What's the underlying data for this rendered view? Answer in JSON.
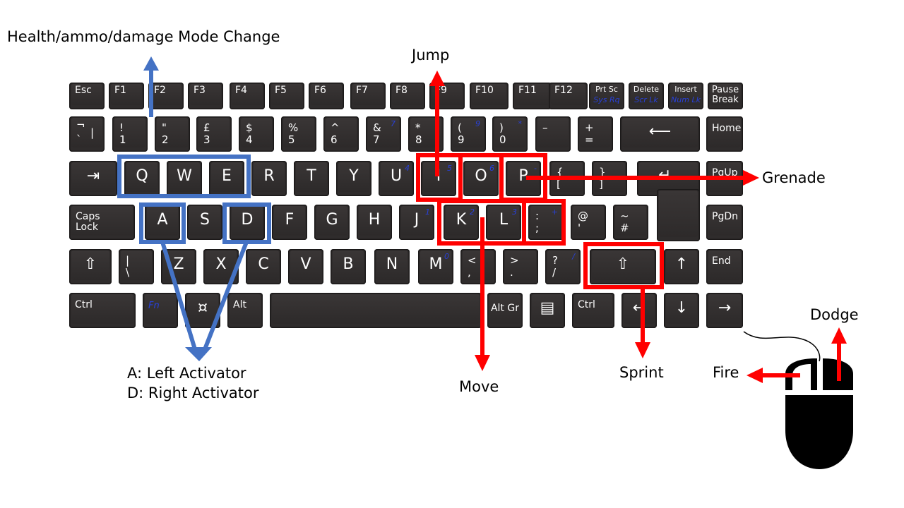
{
  "labels": {
    "health_mode": "Health/ammo/damage  Mode Change",
    "jump": "Jump",
    "grenade": "Grenade",
    "activator_a": "A:  Left Activator",
    "activator_d": "D:  Right Activator",
    "move": "Move",
    "sprint": "Sprint",
    "dodge": "Dodge",
    "fire": "Fire"
  },
  "colors": {
    "key_fill": "#2f2c2c",
    "key_text": "#ffffff",
    "fn_text": "#2840d8",
    "blue_highlight": "#4472c4",
    "red_highlight": "#ff0000",
    "mouse": "#000000"
  },
  "keys": {
    "esc": {
      "main": "Esc"
    },
    "f1": {
      "main": "F1"
    },
    "f2": {
      "main": "F2"
    },
    "f3": {
      "main": "F3"
    },
    "f4": {
      "main": "F4"
    },
    "f5": {
      "main": "F5"
    },
    "f6": {
      "main": "F6"
    },
    "f7": {
      "main": "F7"
    },
    "f8": {
      "main": "F8"
    },
    "f9": {
      "main": "F9"
    },
    "f10": {
      "main": "F10"
    },
    "f11": {
      "main": "F11"
    },
    "f12": {
      "main": "F12"
    },
    "prtsc": {
      "main": "Prt Sc",
      "fn": "Sys Rq"
    },
    "delete": {
      "main": "Delete",
      "fn": "Scr Lk"
    },
    "insert": {
      "main": "Insert",
      "fn": "Num Lk"
    },
    "pause": {
      "main": "Pause",
      "sub": "Break"
    },
    "grave": {
      "top": "¬",
      "bottom": "`",
      "side": "|"
    },
    "d1": {
      "top": "!",
      "bottom": "1"
    },
    "d2": {
      "top": "\"",
      "bottom": "2"
    },
    "d3": {
      "top": "£",
      "bottom": "3"
    },
    "d4": {
      "top": "$",
      "bottom": "4"
    },
    "d5": {
      "top": "%",
      "bottom": "5"
    },
    "d6": {
      "top": "^",
      "bottom": "6"
    },
    "d7": {
      "top": "&",
      "bottom": "7",
      "fn": "7"
    },
    "d8": {
      "top": "*",
      "bottom": "8"
    },
    "d9": {
      "top": "(",
      "bottom": "9",
      "fn": "9"
    },
    "d0": {
      "top": ")",
      "bottom": "0",
      "fn": "*"
    },
    "minus": {
      "top": "–",
      "bottom": ""
    },
    "equals": {
      "top": "+",
      "bottom": "="
    },
    "backspace": {
      "main": "⟵"
    },
    "home": {
      "main": "Home"
    },
    "tab": {
      "main": "⇥"
    },
    "q": {
      "main": "Q"
    },
    "w": {
      "main": "W"
    },
    "e": {
      "main": "E"
    },
    "r": {
      "main": "R"
    },
    "t": {
      "main": "T"
    },
    "y": {
      "main": "Y"
    },
    "u": {
      "main": "U",
      "fn": "4"
    },
    "i": {
      "main": "I",
      "fn": "5"
    },
    "o": {
      "main": "O",
      "fn": "6"
    },
    "p": {
      "main": "P",
      "fn": "-"
    },
    "lbracket": {
      "top": "{",
      "bottom": "["
    },
    "rbracket": {
      "top": "}",
      "bottom": "]"
    },
    "enter": {
      "main": "↵"
    },
    "pgup": {
      "main": "PgUp"
    },
    "caps": {
      "main": "Caps",
      "sub": "Lock"
    },
    "a": {
      "main": "A"
    },
    "s": {
      "main": "S"
    },
    "d": {
      "main": "D"
    },
    "f": {
      "main": "F"
    },
    "g": {
      "main": "G"
    },
    "h": {
      "main": "H"
    },
    "j": {
      "main": "J",
      "fn": "1"
    },
    "k": {
      "main": "K",
      "fn": "2"
    },
    "l": {
      "main": "L",
      "fn": "3"
    },
    "semicolon": {
      "top": ":",
      "bottom": ";",
      "fn": "+"
    },
    "quote": {
      "top": "@",
      "bottom": "'"
    },
    "hash": {
      "top": "~",
      "bottom": "#"
    },
    "pgdn": {
      "main": "PgDn"
    },
    "lshift": {
      "main": "⇧"
    },
    "backslash": {
      "top": "|",
      "bottom": "\\"
    },
    "z": {
      "main": "Z"
    },
    "x": {
      "main": "X"
    },
    "c": {
      "main": "C"
    },
    "v": {
      "main": "V"
    },
    "b": {
      "main": "B"
    },
    "n": {
      "main": "N"
    },
    "m": {
      "main": "M",
      "fn": "0"
    },
    "comma": {
      "top": "<",
      "bottom": ","
    },
    "period": {
      "top": ">",
      "bottom": "."
    },
    "slash": {
      "top": "?",
      "bottom": "/",
      "fn": "/"
    },
    "rshift": {
      "main": "⇧"
    },
    "up": {
      "main": "↑"
    },
    "end": {
      "main": "End"
    },
    "lctrl": {
      "main": "Ctrl"
    },
    "fn": {
      "main": "Fn"
    },
    "win": {
      "main": "¤"
    },
    "alt": {
      "main": "Alt"
    },
    "space": {
      "main": ""
    },
    "altgr": {
      "main": "Alt Gr"
    },
    "menu": {
      "main": "▤"
    },
    "rctrl": {
      "main": "Ctrl"
    },
    "left": {
      "main": "←"
    },
    "down": {
      "main": "↓"
    },
    "right": {
      "main": "→"
    }
  }
}
